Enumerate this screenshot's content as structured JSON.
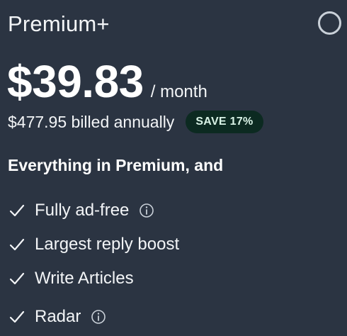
{
  "plan": {
    "name": "Premium+",
    "price": "$39.83",
    "period": "/ month",
    "billing": "$477.95 billed annually",
    "save_badge": "SAVE 17%"
  },
  "features_section": {
    "title": "Everything in Premium, and",
    "items": [
      {
        "label": "Fully ad-free",
        "icon": "check-icon",
        "info": true
      },
      {
        "label": "Largest reply boost",
        "icon": "check-icon",
        "info": false
      },
      {
        "label": "Write Articles",
        "icon": "check-icon",
        "info": false
      },
      {
        "label": "Radar",
        "icon": "check-icon",
        "info": true
      }
    ]
  },
  "colors": {
    "background": "#2b3442",
    "badge_bg": "#0c2a21",
    "badge_text": "#d9f3e6",
    "text": "#f3f5f7"
  }
}
